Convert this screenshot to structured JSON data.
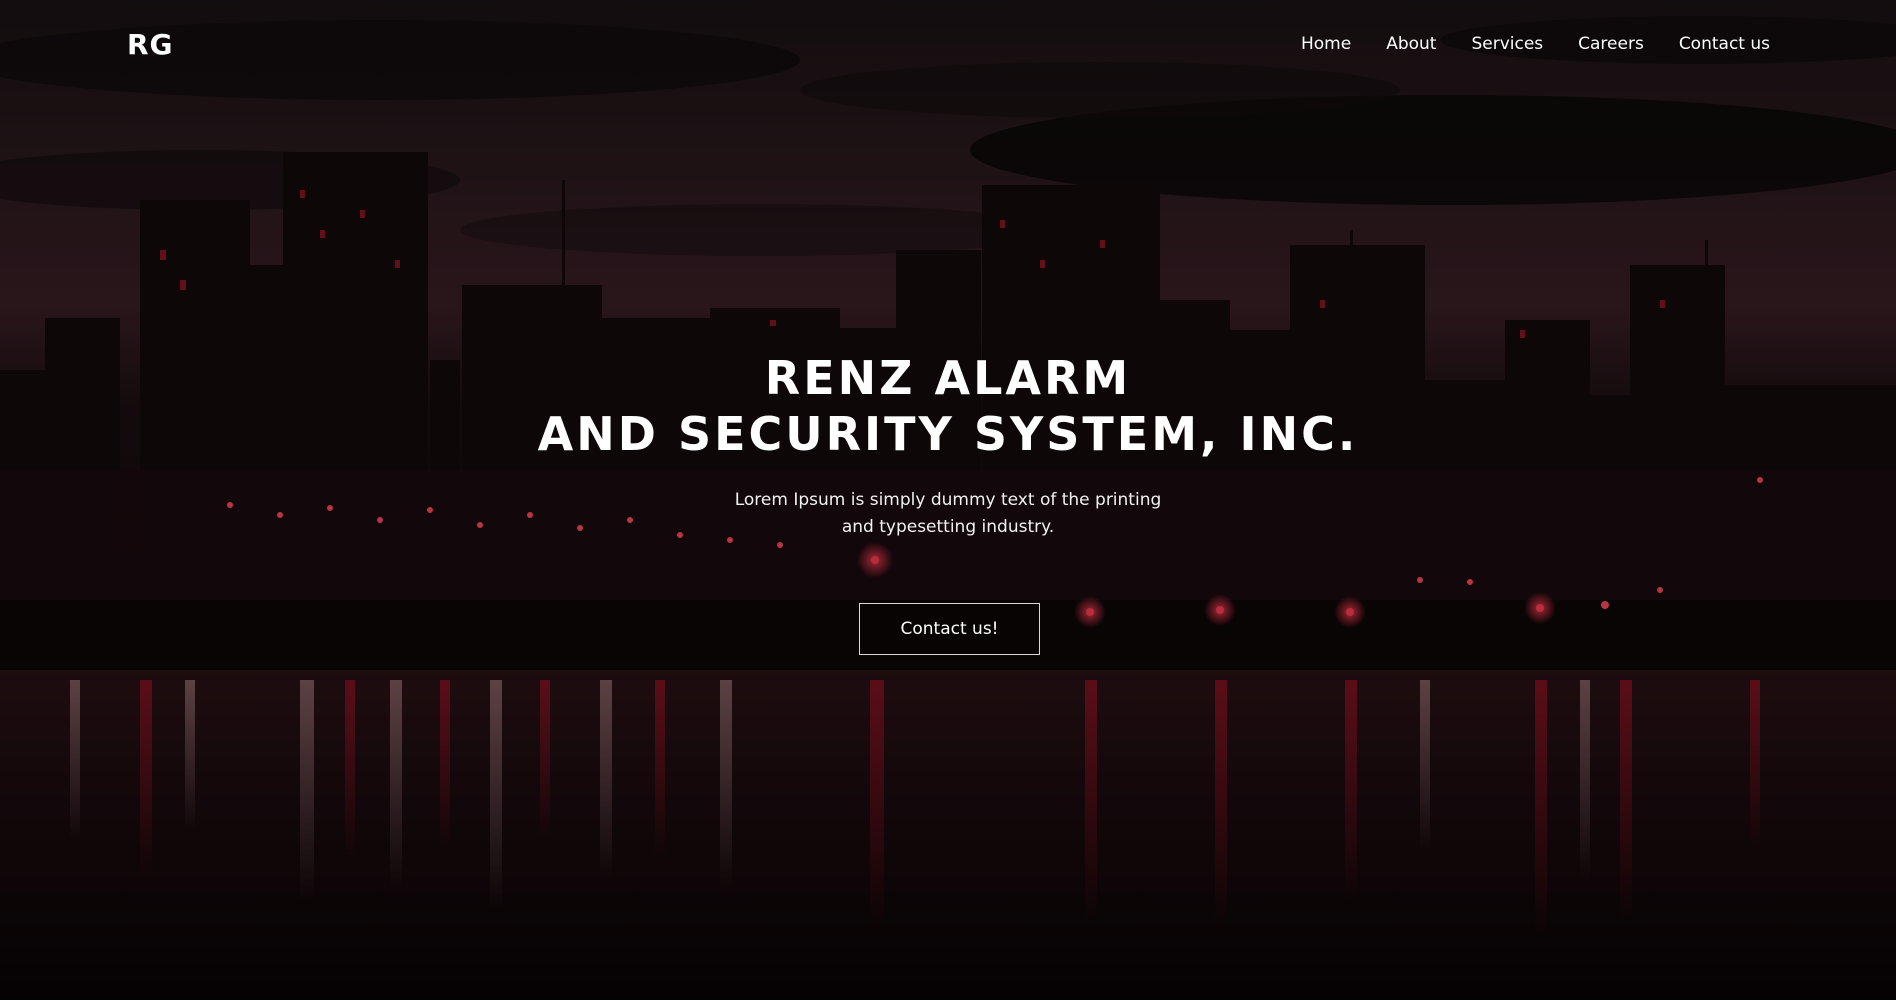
{
  "header": {
    "logo": "RG",
    "nav": [
      {
        "label": "Home"
      },
      {
        "label": "About"
      },
      {
        "label": "Services"
      },
      {
        "label": "Careers"
      },
      {
        "label": "Contact us"
      }
    ]
  },
  "hero": {
    "title_line1": "RENZ ALARM",
    "title_line2": "AND SECURITY SYSTEM, INC.",
    "subtitle_line1": "Lorem Ipsum is simply dummy text of the printing",
    "subtitle_line2": "and typesetting industry.",
    "cta_label": "Contact us!",
    "background": "night-city-skyline-waterfront"
  },
  "colors": {
    "accent_red": "#c4142b",
    "overlay": "#0b0506",
    "text": "#ffffff"
  }
}
